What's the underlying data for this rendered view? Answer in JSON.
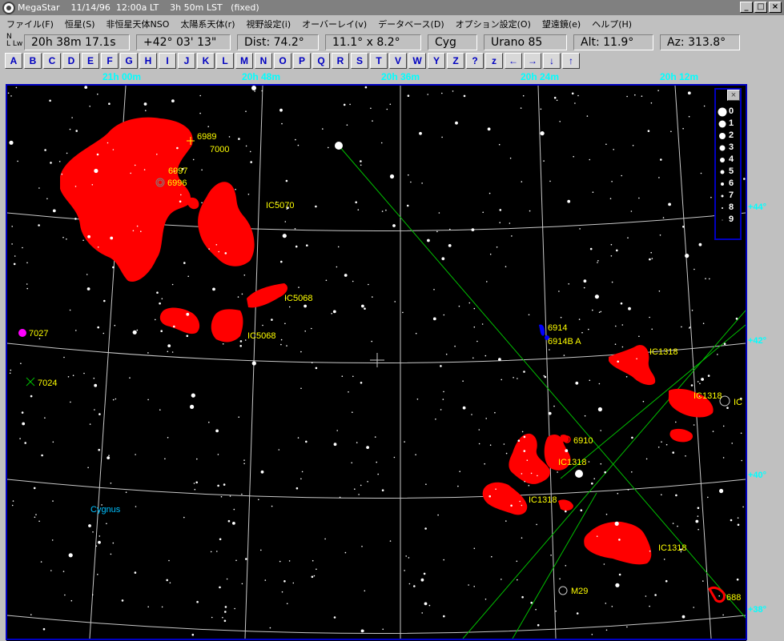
{
  "window": {
    "title": "MegaStar    11/14/96  12:00a LT    3h 50m LST   (fixed)",
    "minimize": "_",
    "maximize": "□",
    "close": "×"
  },
  "menu": [
    "ファイル(F)",
    "恒星(S)",
    "非恒星天体NSO",
    "太陽系天体(r)",
    "視野設定(i)",
    "オーバーレイ(v)",
    "データベース(D)",
    "オプション設定(O)",
    "望遠鏡(e)",
    "ヘルプ(H)"
  ],
  "orientation": {
    "n": "N",
    "lw": "L Lw"
  },
  "info": {
    "ra": "20h 38m 17.1s",
    "dec": "+42° 03' 13\"",
    "dist": "Dist: 74.2°",
    "fov": "11.1° x 8.2°",
    "constellation": "Cyg",
    "atlas": "Urano 85",
    "alt": "Alt: 11.9°",
    "az": "Az: 313.8°"
  },
  "letter_buttons": [
    "A",
    "B",
    "C",
    "D",
    "E",
    "F",
    "G",
    "H",
    "I",
    "J",
    "K",
    "L",
    "M",
    "N",
    "O",
    "P",
    "Q",
    "R",
    "S",
    "T",
    "V",
    "W",
    "Y",
    "Z",
    "?",
    "z",
    "←",
    "→",
    "↓",
    "↑"
  ],
  "ra_labels": [
    "21h 00m",
    "20h 48m",
    "20h 36m",
    "20h 24m",
    "20h 12m"
  ],
  "dec_labels": [
    "+44°",
    "+42°",
    "+40°",
    "+38°"
  ],
  "objects": {
    "n6989": "6989",
    "n7000": "7000",
    "n6997": "6997",
    "n6996": "6996",
    "ic5070": "IC5070",
    "ic5068a": "IC5068",
    "ic5068b": "IC5068",
    "n7027": "7027",
    "n7024": "7024",
    "n6914": "6914",
    "n6914ab": "6914B A",
    "ic1318a": "IC1318",
    "ic1318b": "IC1318",
    "ic1318c": "IC1318",
    "ic1318d": "IC1318",
    "ic1318e": "IC1318",
    "ic_edge": "IC",
    "n6910": "6910",
    "m29": "M29",
    "n688": "688",
    "cygnus": "Cygnus"
  },
  "magnitude_legend": {
    "close": "×",
    "levels": [
      "0",
      "1",
      "2",
      "3",
      "4",
      "5",
      "6",
      "7",
      "8",
      "9"
    ]
  },
  "colors": {
    "nebula": "#ff0000",
    "label": "#ffff00",
    "grid": "#c8c8c8",
    "axis_label": "#00ffff",
    "line": "#00c000",
    "frame": "#0000c0"
  }
}
